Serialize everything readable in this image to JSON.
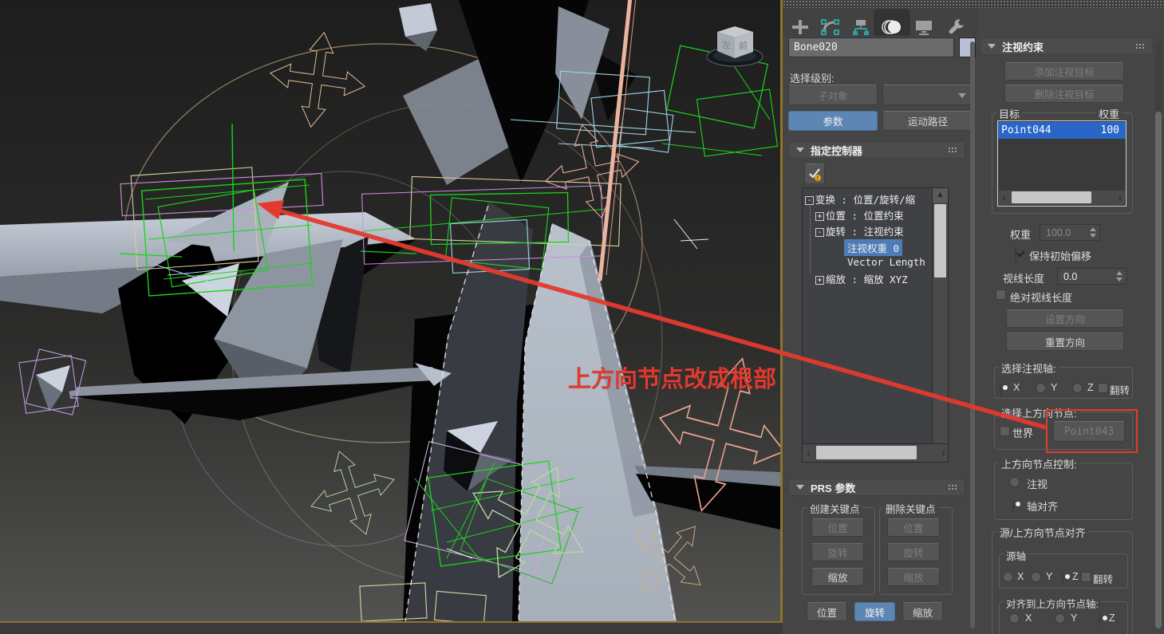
{
  "window": {
    "panel_bg": "#454545",
    "accent_blue": "#5e86b4",
    "selection_blue": "#2a66c8",
    "tree_selection_blue": "#4e7cb8",
    "viewport_border_yellow": "#8f742a",
    "annotation_red": "#e23a30"
  },
  "command_panel": {
    "tabs": [
      {
        "icon": "create-plus-icon",
        "active": false
      },
      {
        "icon": "modify-icon",
        "active": false
      },
      {
        "icon": "hierarchy-icon",
        "active": false
      },
      {
        "icon": "motion-icon",
        "active": true
      },
      {
        "icon": "display-icon",
        "active": false
      },
      {
        "icon": "utilities-wrench-icon",
        "active": false
      }
    ],
    "object_name": "Bone020",
    "selection_level_label": "选择级别:",
    "sub_object_button": "子对象",
    "parameters_button": "参数",
    "motion_paths_button": "运动路径"
  },
  "assign_controller": {
    "title": "指定控制器",
    "tree": [
      {
        "expander": "-",
        "label": "变换 : 位置/旋转/缩",
        "level": 0,
        "selected": false
      },
      {
        "expander": "+",
        "label": "位置 : 位置约束",
        "level": 1,
        "selected": false
      },
      {
        "expander": "-",
        "label": "旋转 : 注视约束",
        "level": 1,
        "selected": false
      },
      {
        "expander": "",
        "label": "注视权重 0",
        "level": 2,
        "selected": true
      },
      {
        "expander": "",
        "label": "Vector Length",
        "level": 2,
        "selected": false
      },
      {
        "expander": "+",
        "label": "缩放 : 缩放 XYZ",
        "level": 1,
        "selected": false
      }
    ]
  },
  "prs": {
    "title": "PRS 参数",
    "create_keys_label": "创建关键点",
    "delete_keys_label": "删除关键点",
    "position_label": "位置",
    "rotation_label": "旋转",
    "scale_label": "缩放",
    "bottom_active": "旋转"
  },
  "lookat": {
    "title": "注视约束",
    "add_target_button": "添加注视目标",
    "delete_target_button": "删除注视目标",
    "target_header": "目标",
    "weight_header": "权重",
    "targets": [
      {
        "name": "Point044",
        "weight": "100"
      }
    ],
    "weight_label": "权重",
    "weight_value": "100.0",
    "keep_offset_label": "保持初始偏移",
    "keep_offset_checked": true,
    "view_length_label": "视线长度",
    "view_length_value": "0.0",
    "absolute_length_label": "绝对视线长度",
    "absolute_length_checked": false,
    "set_orientation_button": "设置方向",
    "reset_orientation_button": "重置方向",
    "lookat_axis_group": "选择注视轴:",
    "axis_x": "X",
    "axis_y": "Y",
    "axis_z": "Z",
    "flip_label": "翻转",
    "lookat_axis_selected": "X",
    "upnode_group": "选择上方向节点:",
    "world_label": "世界",
    "world_checked": false,
    "upnode_button": "Point043",
    "upnode_control_group": "上方向节点控制:",
    "lookat_option": "注视",
    "axis_align_option": "轴对齐",
    "upnode_control_selected": "轴对齐",
    "source_align_group": "源/上方向节点对齐",
    "source_axis_group": "源轴",
    "source_axis_selected": "Z",
    "aligned_to_group": "对齐到上方向节点轴:",
    "aligned_to_selected": "Z"
  },
  "viewport": {
    "annotation_text": "上方向节点改成根部",
    "viewcube": {
      "front_label": "前",
      "left_label": "左"
    }
  }
}
